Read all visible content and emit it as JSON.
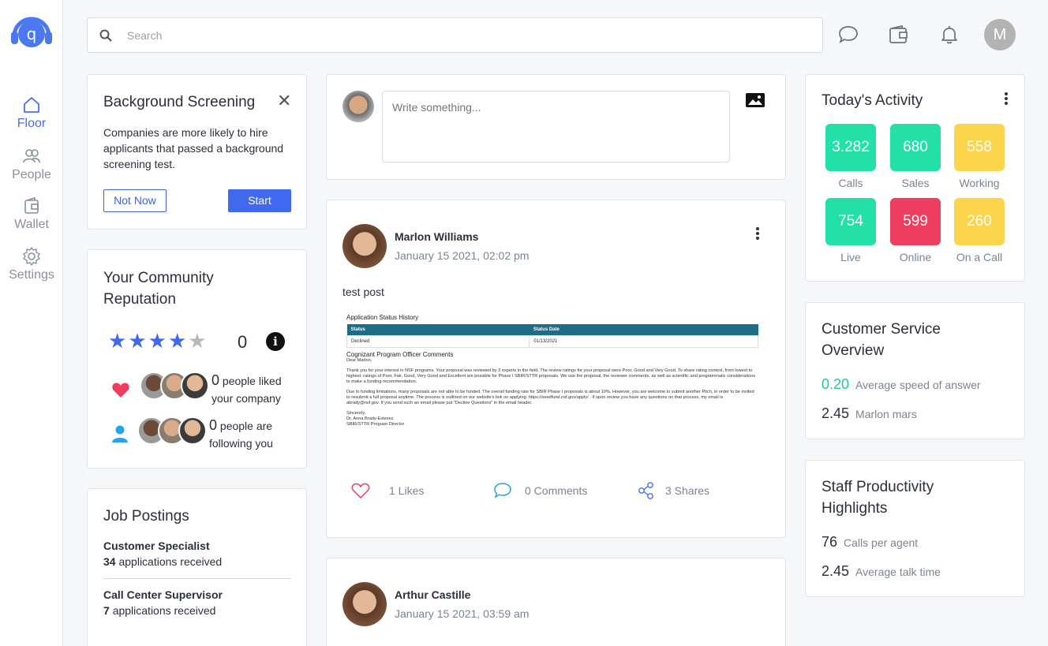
{
  "nav": {
    "logo_letter": "q",
    "items": [
      {
        "label": "Floor",
        "icon": "home-icon",
        "active": true
      },
      {
        "label": "People",
        "icon": "people-icon",
        "active": false
      },
      {
        "label": "Wallet",
        "icon": "wallet-icon",
        "active": false
      },
      {
        "label": "Settings",
        "icon": "gear-icon",
        "active": false
      }
    ]
  },
  "topbar": {
    "search_placeholder": "Search",
    "user_initial": "M"
  },
  "background_screening": {
    "title": "Background Screening",
    "close": "✕",
    "text": "Companies are more likely to hire applicants that passed a background screening test.",
    "not_now": "Not Now",
    "start": "Start"
  },
  "reputation": {
    "title": "Your Community Reputation",
    "rating": 4.5,
    "score": "0",
    "info": "i",
    "liked_count": "0",
    "liked_text_1": "people liked",
    "liked_text_2": "your company",
    "following_count": "0",
    "following_text_1": "people are",
    "following_text_2": "following you"
  },
  "jobs": {
    "title": "Job Postings",
    "items": [
      {
        "title": "Customer Specialist",
        "count": "34",
        "suffix": "applications received"
      },
      {
        "title": "Call Center Supervisor",
        "count": "7",
        "suffix": "applications received"
      }
    ]
  },
  "composer": {
    "placeholder": "Write something..."
  },
  "posts": [
    {
      "author": "Marlon Williams",
      "date": "January 15 2021, 02:02 pm",
      "text": "test post",
      "attachment": {
        "heading": "Application Status History",
        "col_status": "Status",
        "col_date": "Status Date",
        "row_status": "Declined",
        "row_date": "01/13/2021",
        "section": "Cognizant Program Officer Comments",
        "greeting": "Dear Marlon,",
        "para1": "Thank you for your interest in NSF programs. Your proposal was reviewed by 3 experts in the field. The review ratings for your proposal were Poor, Good and Very Good. To share rating context, from lowest to highest: ratings of Poor, Fair, Good, Very Good and Excellent are possible for Phase I SBIR/STTR proposals. We use the proposal, the reviewer comments, as well as scientific and programmatic considerations to make a funding recommendation.",
        "para2": "Due to funding limitations, many proposals are not able to be funded. The overall funding rate for SBIR Phase I proposals is about 10%. However, you are welcome to submit another Pitch, in order to be invited to resubmit a full proposal anytime. The process is outlined on our website's link on applying: https://seedfund.nsf.gov/apply/ . If upon review you have any questions on that process, my email is abrady@nsf.gov. If you send such an email please put \"Decline Questions\" in the email header.",
        "sign1": "Sincerely,",
        "sign2": "Dr. Anna Brady-Estevez",
        "sign3": "SBIR/STTR Program Director"
      },
      "likes": "1 Likes",
      "comments": "0 Comments",
      "shares": "3 Shares"
    },
    {
      "author": "Arthur Castille",
      "date": "January 15 2021, 03:59 am"
    }
  ],
  "activity": {
    "title": "Today's Activity",
    "tiles": [
      {
        "value": "3.282",
        "label": "Calls",
        "color": "#22e0a8"
      },
      {
        "value": "680",
        "label": "Sales",
        "color": "#22e0a8"
      },
      {
        "value": "558",
        "label": "Working",
        "color": "#fcd54d"
      },
      {
        "value": "754",
        "label": "Live",
        "color": "#22e0a8"
      },
      {
        "value": "599",
        "label": "Online",
        "color": "#ee3d5e"
      },
      {
        "value": "260",
        "label": "On a Call",
        "color": "#fcd54d"
      }
    ]
  },
  "customer_service": {
    "title": "Customer Service Overview",
    "m1_value": "0.20",
    "m1_label": "Average speed of answer",
    "m2_value": "2.45",
    "m2_label": "Marlon mars"
  },
  "staff": {
    "title": "Staff Productivity Highlights",
    "m1_value": "76",
    "m1_label": "Calls per agent",
    "m2_value": "2.45",
    "m2_label": "Average talk time"
  }
}
